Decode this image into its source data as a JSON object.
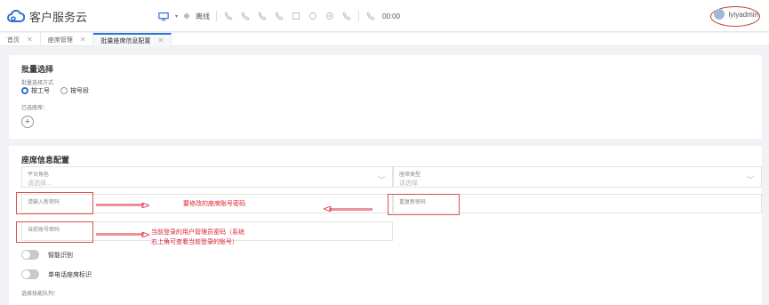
{
  "header": {
    "app_title": "客户服务云",
    "status_label": "离线",
    "timer": "00:00",
    "user_name": "lyiyadmin"
  },
  "tabs": [
    {
      "label": "首页"
    },
    {
      "label": "座席管理"
    },
    {
      "label": "批量座席信息配置"
    }
  ],
  "batch_select": {
    "title": "批量选择",
    "method_label": "批量选择方式",
    "options": [
      "按工号",
      "按号段"
    ],
    "selected_label": "已选座席："
  },
  "seat_config": {
    "title": "座席信息配置",
    "platform_role": {
      "label": "平台角色",
      "placeholder": "请选择..."
    },
    "seat_type": {
      "label": "座席类型",
      "placeholder": "请选择"
    },
    "new_password_label": "请输入新密码",
    "confirm_password_label": "重复新密码",
    "current_password_label": "当前账号密码",
    "smart_recognition": "智能识别",
    "single_phone_flag": "单电话座席标识",
    "skill_queue_label": "选择技能队列："
  },
  "annotations": {
    "note1": "要修改的座席账号密码",
    "note2_line1": "当前登录的用户管理员密码（系统",
    "note2_line2": "右上角可查看当前登录的账号）"
  },
  "colors": {
    "accent": "#2f6fd6",
    "annotation_red": "#d9232e"
  }
}
